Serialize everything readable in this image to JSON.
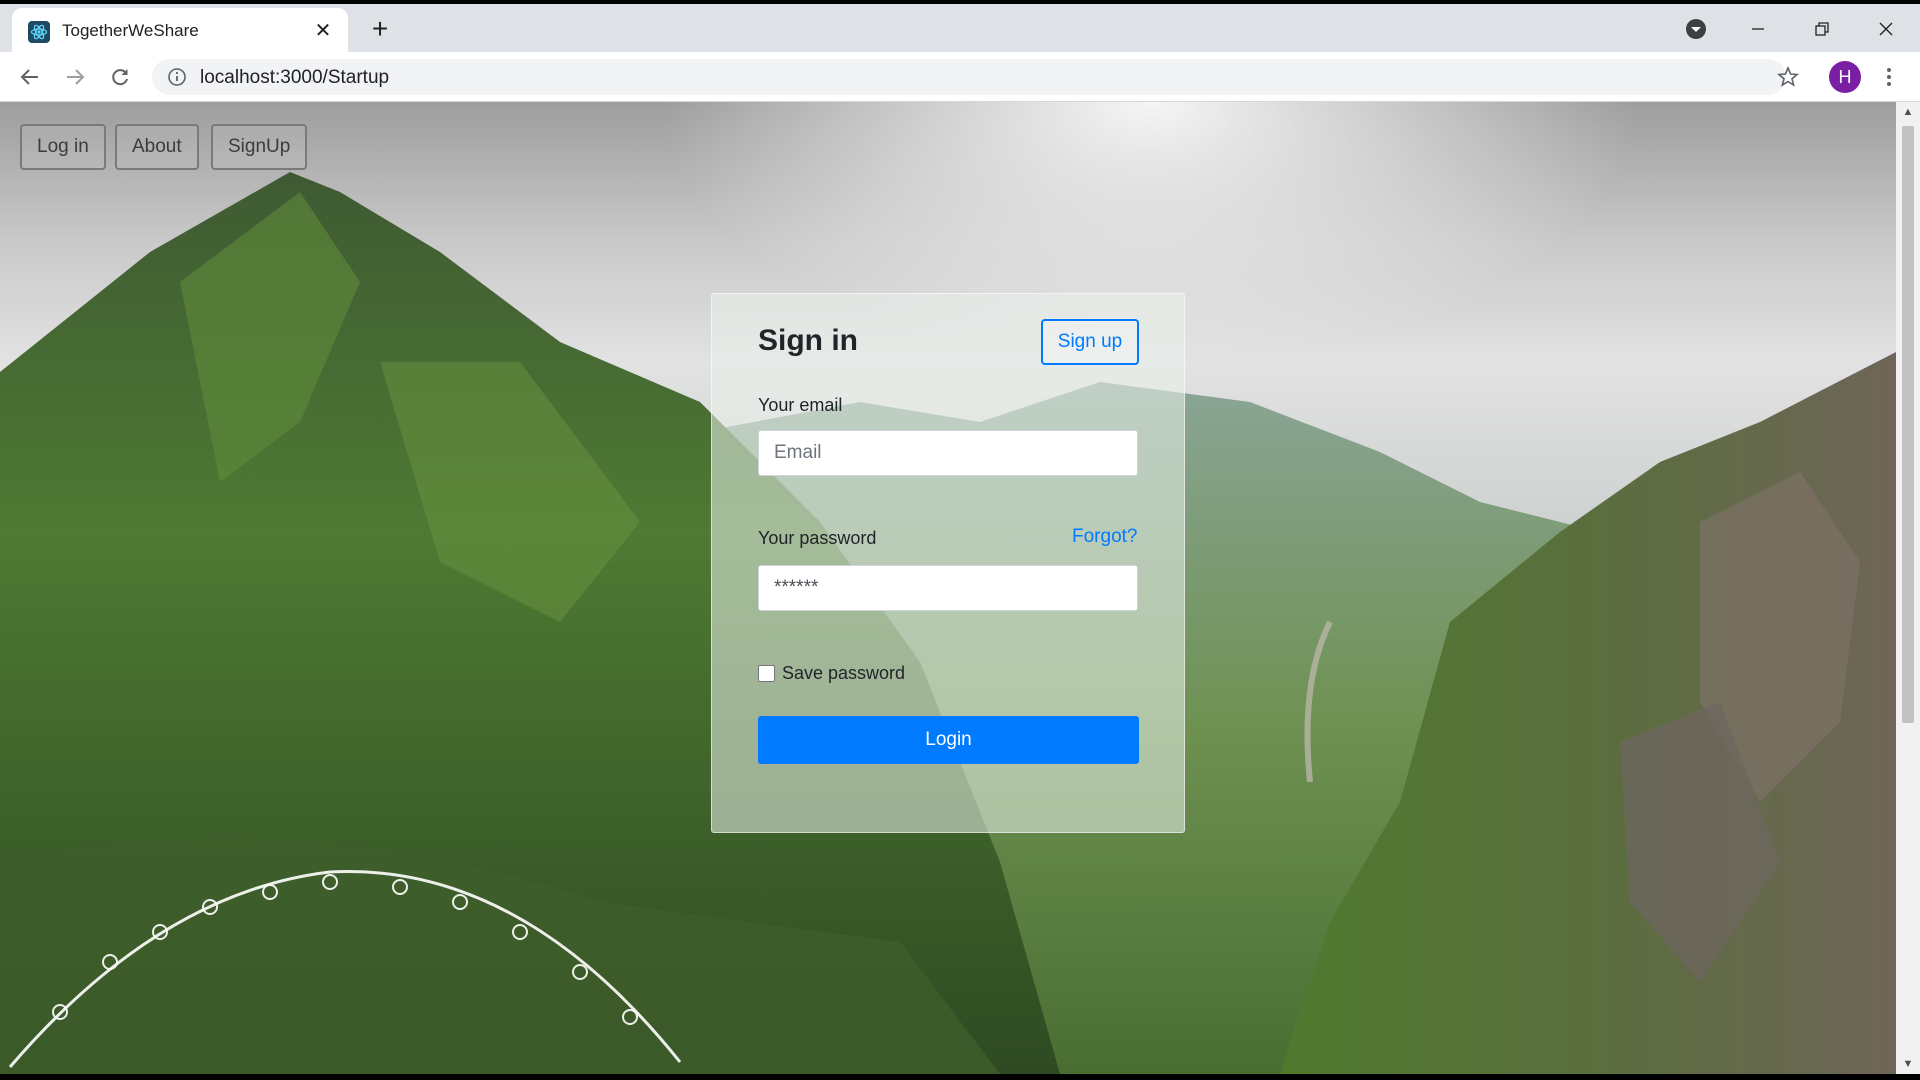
{
  "browser": {
    "tab_title": "TogetherWeShare",
    "tab_close": "✕",
    "new_tab": "+",
    "url": "localhost:3000/Startup",
    "avatar_letter": "H",
    "icons": {
      "back": "arrow-left-icon",
      "forward": "arrow-right-icon",
      "reload": "reload-icon",
      "info": "info-icon",
      "star": "star-icon",
      "menu": "kebab-menu-icon",
      "profile_dropdown": "dropdown-circle-icon"
    },
    "colors": {
      "avatar": "#7b1fa2",
      "tab_strip": "#dee1e6"
    }
  },
  "nav": {
    "login": "Log in",
    "about": "About",
    "signup": "SignUp"
  },
  "signin": {
    "title": "Sign in",
    "signup_button": "Sign up",
    "email_label": "Your email",
    "email_placeholder": "Email",
    "password_label": "Your password",
    "forgot_link": "Forgot?",
    "password_value": "******",
    "save_password_label": "Save password",
    "login_button": "Login",
    "colors": {
      "primary": "#007bff"
    }
  }
}
